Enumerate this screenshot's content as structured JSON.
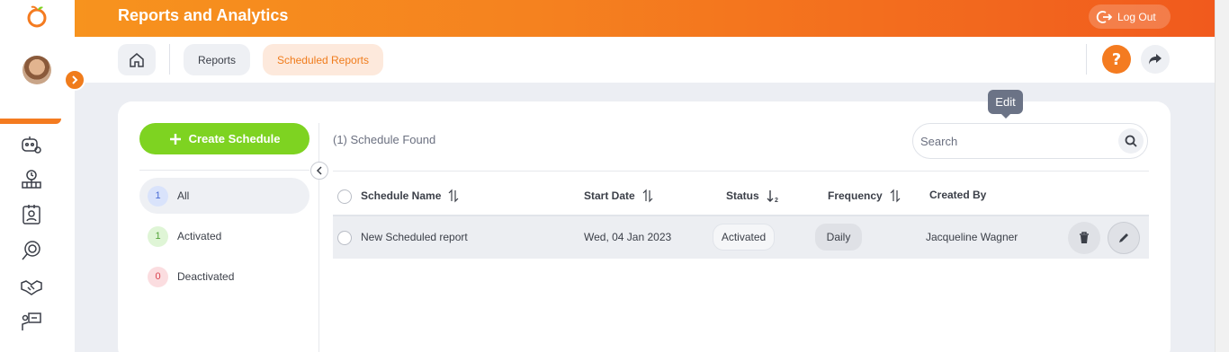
{
  "app": {
    "title": "Reports and Analytics",
    "logout_label": "Log Out"
  },
  "breadcrumb": {
    "reports": "Reports",
    "scheduled_reports": "Scheduled Reports"
  },
  "help": {
    "label": "?"
  },
  "sidebar_icons": [
    "bot-settings-icon",
    "org-chart-clock-icon",
    "id-badge-icon",
    "target-search-icon",
    "handshake-icon",
    "presentation-icon"
  ],
  "create_button": {
    "label": "Create Schedule"
  },
  "filters": [
    {
      "count": "1",
      "label": "All"
    },
    {
      "count": "1",
      "label": "Activated"
    },
    {
      "count": "0",
      "label": "Deactivated"
    }
  ],
  "results": {
    "found_text": "(1) Schedule Found"
  },
  "search": {
    "placeholder": "Search"
  },
  "table": {
    "columns": [
      "Schedule Name",
      "Start Date",
      "Status",
      "Frequency",
      "Created By"
    ],
    "rows": [
      {
        "name": "New Scheduled report",
        "start_date": "Wed, 04 Jan 2023",
        "status": "Activated",
        "frequency": "Daily",
        "created_by": "Jacqueline Wagner"
      }
    ]
  },
  "tooltip": {
    "label": "Edit"
  },
  "colors": {
    "brand_orange": "#f47b20",
    "create_green": "#7ed321",
    "active_crumb_bg": "#fde9dc"
  }
}
